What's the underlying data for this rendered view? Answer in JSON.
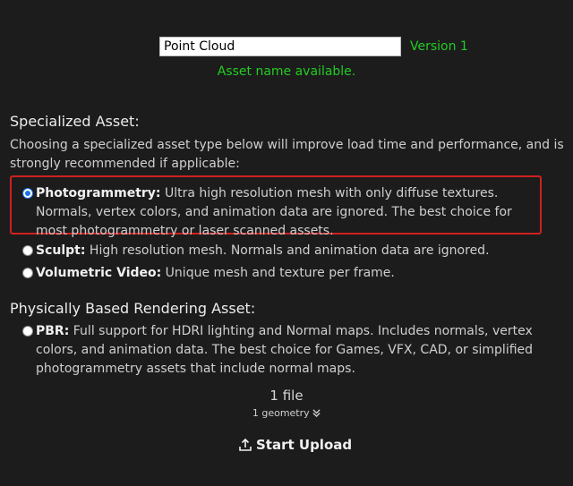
{
  "asset": {
    "name_value": "Point Cloud",
    "version": "Version 1",
    "availability": "Asset name available."
  },
  "specialized": {
    "heading": "Specialized Asset:",
    "description": "Choosing a specialized asset type below will improve load time and performance, and is strongly recommended if applicable:",
    "options": [
      {
        "label": "Photogrammetry:",
        "text": " Ultra high resolution mesh with only diffuse textures. Normals, vertex colors, and animation data are ignored. The best choice for most photogrammetry or laser scanned assets.",
        "selected": true
      },
      {
        "label": "Sculpt:",
        "text": " High resolution mesh. Normals and animation data are ignored.",
        "selected": false
      },
      {
        "label": "Volumetric Video:",
        "text": " Unique mesh and texture per frame.",
        "selected": false
      }
    ]
  },
  "pbr": {
    "heading": "Physically Based Rendering Asset:",
    "option": {
      "label": "PBR:",
      "text": " Full support for HDRI lighting and Normal maps. Includes normals, vertex colors, and animation data. The best choice for Games, VFX, CAD, or simplified photogrammetry assets that include normal maps.",
      "selected": false
    }
  },
  "summary": {
    "files": "1 file",
    "geometry": "1 geometry"
  },
  "upload": {
    "label": "Start Upload",
    "icon": "upload-icon"
  },
  "colors": {
    "background": "#1c1c1c",
    "success": "#22cc22",
    "highlight_border": "#d02020",
    "radio_selected": "#1a73e8"
  }
}
